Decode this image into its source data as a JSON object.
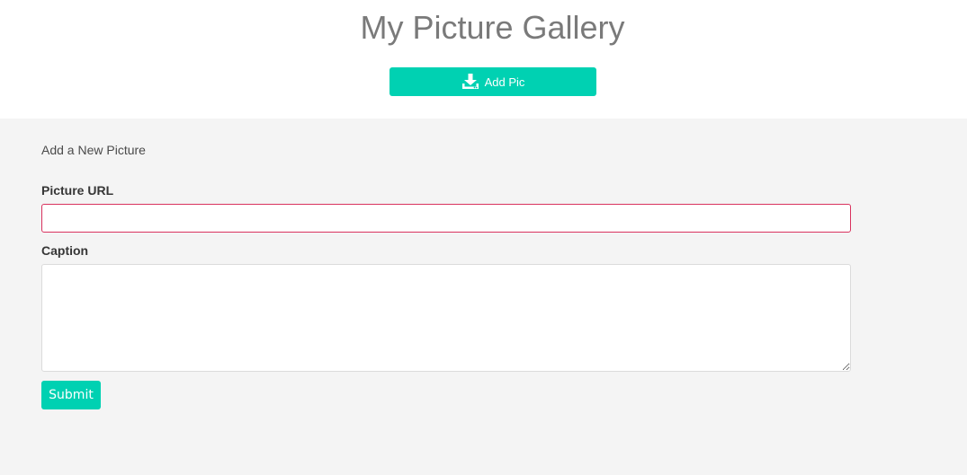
{
  "header": {
    "title": "My Picture Gallery",
    "add_button": {
      "label": "Add Pic",
      "icon": "download-icon"
    }
  },
  "form": {
    "heading": "Add a New Picture",
    "url_label": "Picture URL",
    "url_value": "",
    "caption_label": "Caption",
    "caption_value": "",
    "submit_label": "Submit"
  },
  "colors": {
    "accent": "#00d1b2",
    "error_border": "#d9325e",
    "panel_background": "#f4f4f4",
    "title_text": "#7a7a7a"
  }
}
